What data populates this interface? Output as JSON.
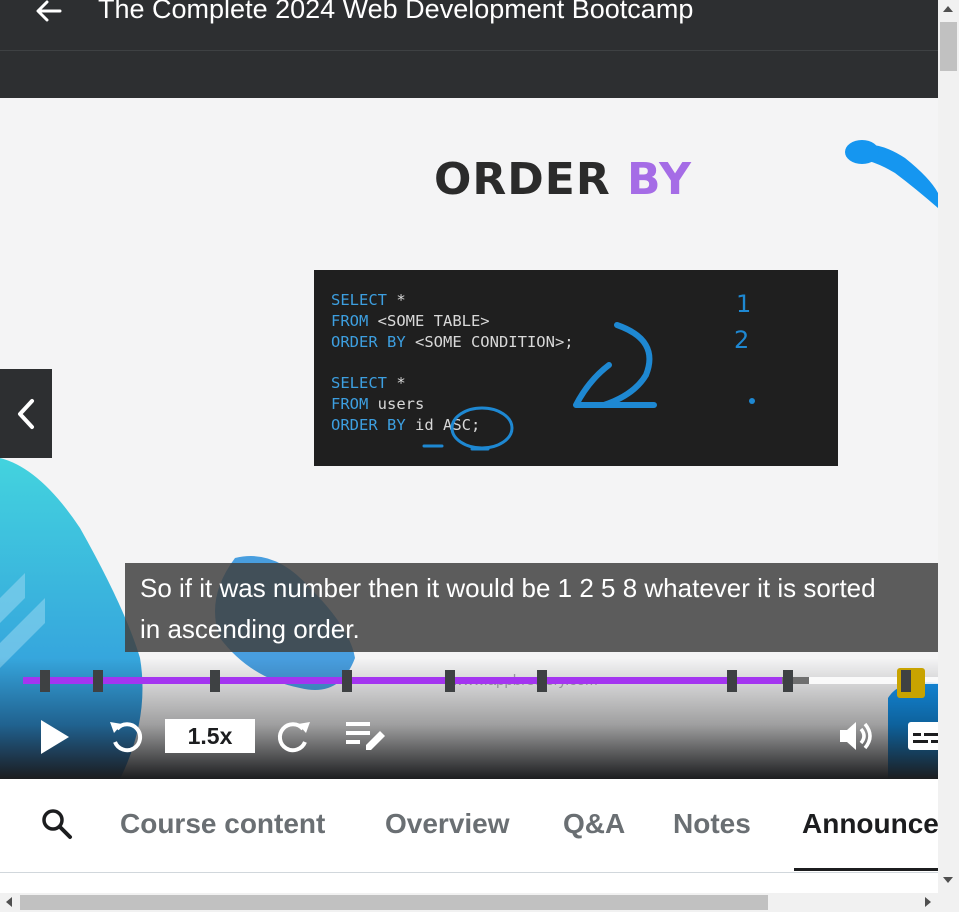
{
  "header": {
    "course_title": "The Complete 2024 Web Development Bootcamp"
  },
  "slide": {
    "title_main": "ORDER",
    "title_accent": "BY",
    "code_lines": [
      {
        "kw": "SELECT",
        "rest": " *"
      },
      {
        "kw": "FROM",
        "rest": " <SOME TABLE>"
      },
      {
        "kw": "ORDER BY",
        "rest": " <SOME CONDITION>;"
      },
      {
        "kw": "",
        "rest": ""
      },
      {
        "kw": "SELECT",
        "rest": " *"
      },
      {
        "kw": "FROM",
        "rest": " users"
      },
      {
        "kw": "ORDER BY",
        "rest": " id ASC;"
      }
    ],
    "handwritten_numbers": [
      "1",
      "2"
    ],
    "watermark": "www.appbrewery.com"
  },
  "caption": {
    "line1": "So if it was number then it would be 1 2 5 8 whatever it is sorted",
    "line2": "in ascending order."
  },
  "player": {
    "speed": "1.5x",
    "progress_fraction": 0.83,
    "accent_color": "#a435f0"
  },
  "tabs": [
    {
      "label": "Course content",
      "active": false
    },
    {
      "label": "Overview",
      "active": false
    },
    {
      "label": "Q&A",
      "active": false
    },
    {
      "label": "Notes",
      "active": false
    },
    {
      "label": "Announcements",
      "active": true
    }
  ],
  "icons": [
    "back-arrow-icon",
    "chevron-left-icon",
    "play-icon",
    "rewind-icon",
    "forward-icon",
    "notes-icon",
    "volume-icon",
    "captions-icon",
    "search-icon"
  ]
}
